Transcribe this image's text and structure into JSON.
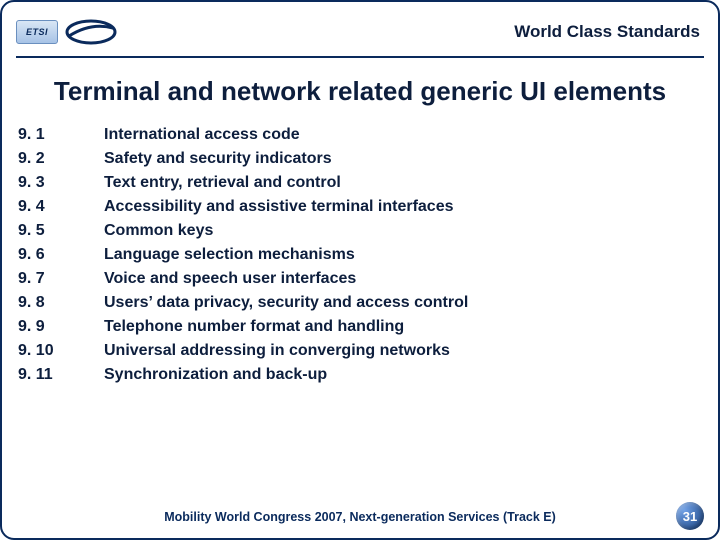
{
  "header": {
    "logo_text": "ETSI",
    "right_text": "World Class Standards"
  },
  "title": "Terminal and network related generic UI elements",
  "items": [
    {
      "num": "9. 1",
      "text": "International access code"
    },
    {
      "num": "9. 2",
      "text": "Safety and security indicators"
    },
    {
      "num": "9. 3",
      "text": "Text entry, retrieval and control"
    },
    {
      "num": "9. 4",
      "text": "Accessibility and assistive terminal interfaces"
    },
    {
      "num": "9. 5",
      "text": "Common keys"
    },
    {
      "num": "9. 6",
      "text": "Language selection mechanisms"
    },
    {
      "num": "9. 7",
      "text": "Voice and speech user interfaces"
    },
    {
      "num": "9. 8",
      "text": "Users’ data privacy, security and access control"
    },
    {
      "num": "9. 9",
      "text": "Telephone number format and handling"
    },
    {
      "num": "9. 10",
      "text": "Universal addressing in converging networks"
    },
    {
      "num": "9. 11",
      "text": "Synchronization and back-up"
    }
  ],
  "footer": "Mobility World Congress 2007, Next-generation Services (Track E)",
  "page_number": "31"
}
